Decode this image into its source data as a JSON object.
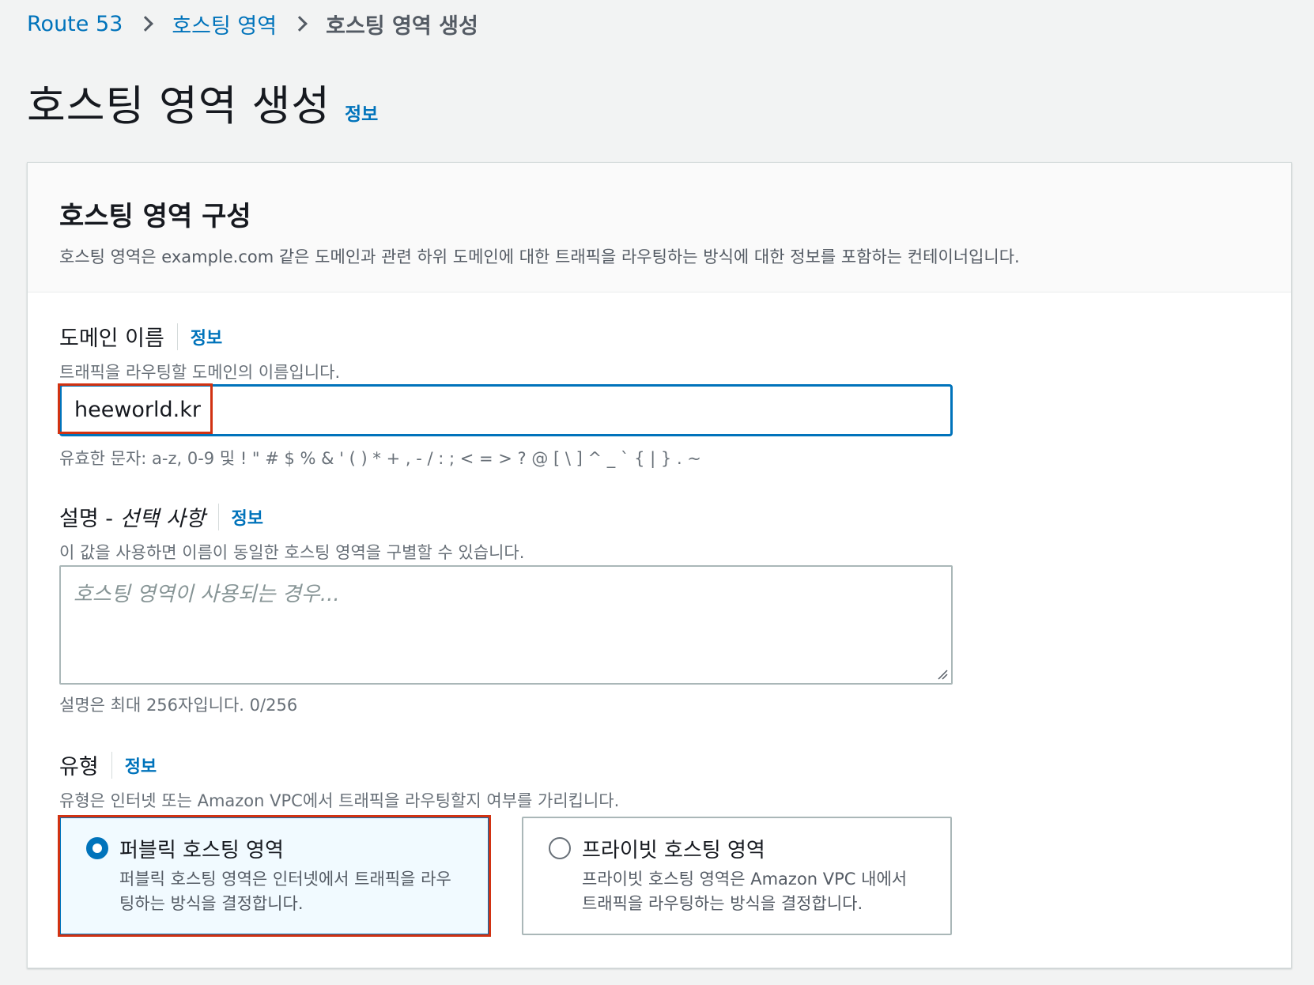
{
  "breadcrumb": {
    "items": [
      "Route 53",
      "호스팅 영역"
    ],
    "current": "호스팅 영역 생성"
  },
  "page": {
    "title": "호스팅 영역 생성",
    "info": "정보"
  },
  "panel": {
    "title": "호스팅 영역 구성",
    "description": "호스팅 영역은 example.com 같은 도메인과 관련 하위 도메인에 대한 트래픽을 라우팅하는 방식에 대한 정보를 포함하는 컨테이너입니다."
  },
  "domain": {
    "label": "도메인 이름",
    "info": "정보",
    "description": "트래픽을 라우팅할 도메인의 이름입니다.",
    "value": "heeworld.kr",
    "valid_chars": "유효한 문자: a-z, 0-9 및 ! \" # $ % & ' ( ) * + , - / : ; < = > ? @ [ \\ ] ^ _ ` { | } . ~"
  },
  "description_field": {
    "label": "설명 - ",
    "label_optional": "선택 사항",
    "info": "정보",
    "description": "이 값을 사용하면 이름이 동일한 호스팅 영역을 구별할 수 있습니다.",
    "placeholder": "호스팅 영역이 사용되는 경우...",
    "char_count": "설명은 최대 256자입니다. 0/256"
  },
  "type": {
    "label": "유형",
    "info": "정보",
    "description": "유형은 인터넷 또는 Amazon VPC에서 트래픽을 라우팅할지 여부를 가리킵니다.",
    "options": [
      {
        "title": "퍼블릭 호스팅 영역",
        "description": "퍼블릭 호스팅 영역은 인터넷에서 트래픽을 라우팅하는 방식을 결정합니다.",
        "selected": true
      },
      {
        "title": "프라이빗 호스팅 영역",
        "description": "프라이빗 호스팅 영역은 Amazon VPC 내에서 트래픽을 라우팅하는 방식을 결정합니다.",
        "selected": false
      }
    ]
  },
  "colors": {
    "link": "#0073bb",
    "highlight": "#d13212",
    "selected_bg": "#f1faff"
  }
}
